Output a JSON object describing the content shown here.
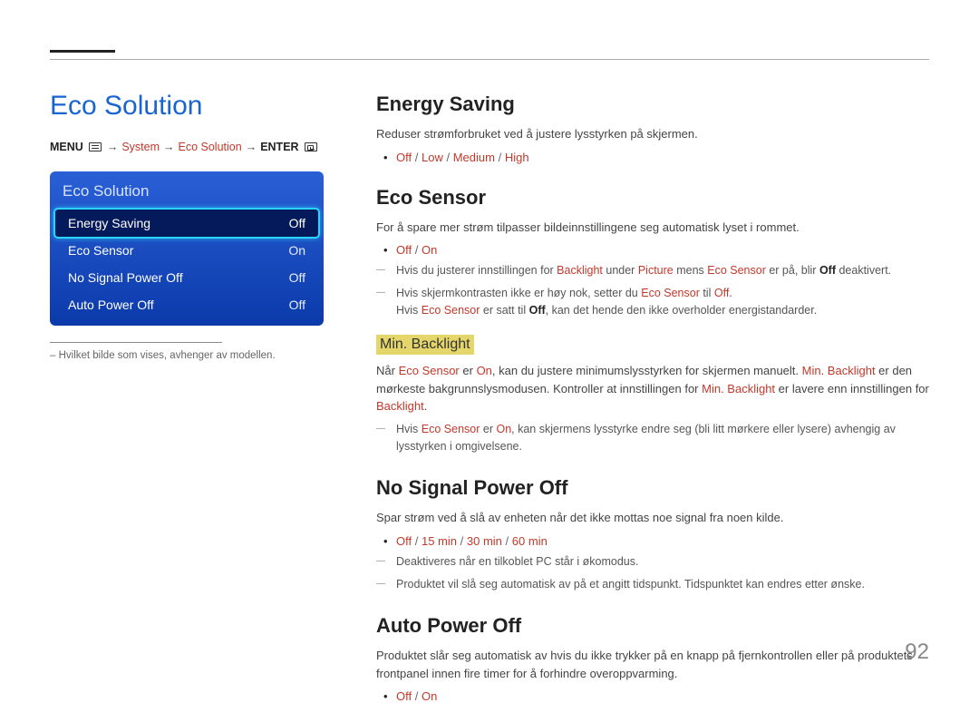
{
  "page_title": "Eco Solution",
  "breadcrumb": {
    "menu": "MENU",
    "system": "System",
    "eco": "Eco Solution",
    "enter": "ENTER"
  },
  "menu": {
    "header": "Eco Solution",
    "items": [
      {
        "label": "Energy Saving",
        "value": "Off"
      },
      {
        "label": "Eco Sensor",
        "value": "On"
      },
      {
        "label": "No Signal Power Off",
        "value": "Off"
      },
      {
        "label": "Auto Power Off",
        "value": "Off"
      }
    ]
  },
  "left_note": "–  Hvilket bilde som vises, avhenger av modellen.",
  "sections": {
    "energy": {
      "title": "Energy Saving",
      "desc": "Reduser strømforbruket ved å justere lysstyrken på skjermen.",
      "opt1": "Off",
      "opt2": "Low",
      "opt3": "Medium",
      "opt4": "High"
    },
    "eco_sensor": {
      "title": "Eco Sensor",
      "desc": "For å spare mer strøm tilpasser bildeinnstillingene seg automatisk lyset i rommet.",
      "opt1": "Off",
      "opt2": "On",
      "note1a": "Hvis du justerer innstillingen for ",
      "note1b": "Backlight",
      "note1c": " under ",
      "note1d": "Picture",
      "note1e": " mens ",
      "note1f": "Eco Sensor",
      "note1g": " er på, blir ",
      "note1h": "Off",
      "note1i": " deaktivert.",
      "note2a": "Hvis skjermkontrasten ikke er høy nok, setter du ",
      "note2b": "Eco Sensor",
      "note2c": " til ",
      "note2d": "Off",
      "note2e": ".",
      "note3a": "Hvis ",
      "note3b": "Eco Sensor",
      "note3c": " er satt til ",
      "note3d": "Off",
      "note3e": ", kan det hende den ikke overholder energistandarder."
    },
    "min_backlight": {
      "title": "Min. Backlight",
      "p1a": "Når ",
      "p1b": "Eco Sensor",
      "p1c": " er ",
      "p1d": "On",
      "p1e": ", kan du justere minimumslysstyrken for skjermen manuelt. ",
      "p1f": "Min. Backlight",
      "p1g": " er den mørkeste bakgrunnslysmodusen. Kontroller at innstillingen for ",
      "p1h": "Min. Backlight",
      "p1i": " er lavere enn innstillingen for ",
      "p1j": "Backlight",
      "p1k": ".",
      "note1a": "Hvis ",
      "note1b": "Eco Sensor",
      "note1c": " er ",
      "note1d": "On",
      "note1e": ", kan skjermens lysstyrke endre seg (bli litt mørkere eller lysere) avhengig av lysstyrken i omgivelsene."
    },
    "no_signal": {
      "title": "No Signal Power Off",
      "desc": "Spar strøm ved å slå av enheten når det ikke mottas noe signal fra noen kilde.",
      "opt1": "Off",
      "opt2": "15 min",
      "opt3": "30 min",
      "opt4": "60 min",
      "note1": "Deaktiveres når en tilkoblet PC står i økomodus.",
      "note2": "Produktet vil slå seg automatisk av på et angitt tidspunkt. Tidspunktet kan endres etter ønske."
    },
    "auto_off": {
      "title": "Auto Power Off",
      "desc": "Produktet slår seg automatisk av hvis du ikke trykker på en knapp på fjernkontrollen eller på produktets frontpanel innen fire timer for å forhindre overoppvarming.",
      "opt1": "Off",
      "opt2": "On"
    }
  },
  "page_number": "92"
}
